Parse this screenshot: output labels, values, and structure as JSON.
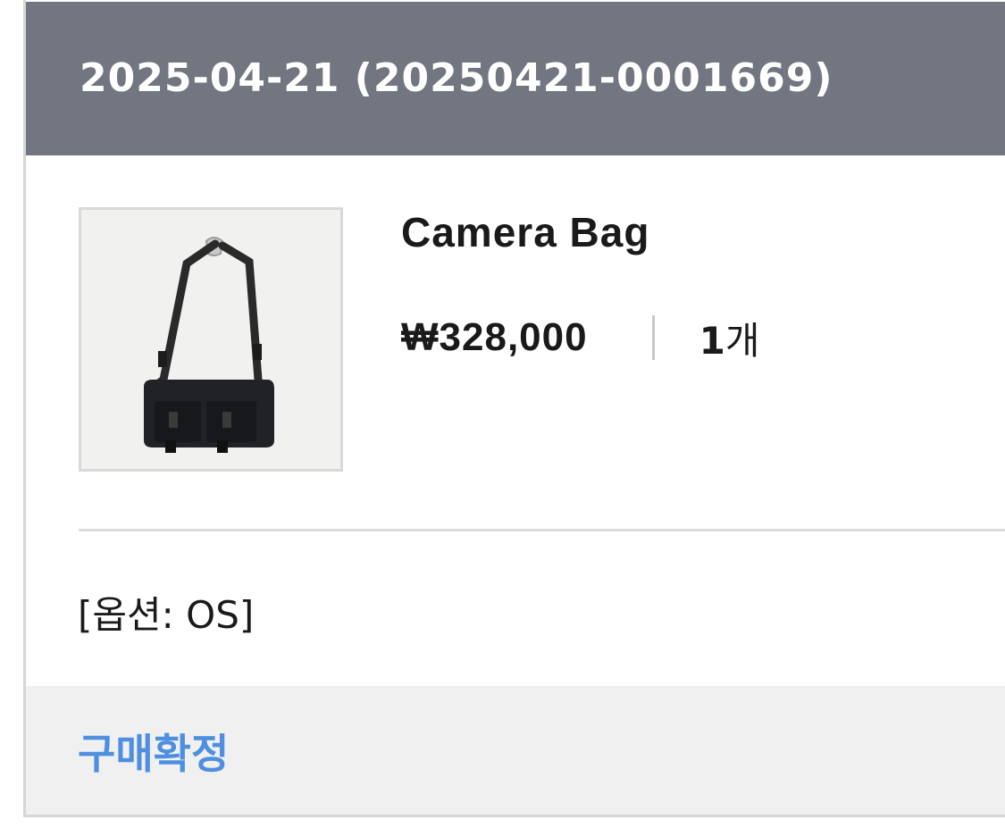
{
  "order": {
    "header": "2025-04-21 (20250421-0001669)"
  },
  "item": {
    "image_alt": "Camera Bag",
    "name": "Camera Bag",
    "price": "₩328,000",
    "quantity_number": "1",
    "quantity_unit": "개",
    "option": "[옵션: OS]"
  },
  "actions": {
    "confirm_label": "구매확정"
  },
  "colors": {
    "header_bg": "#717680",
    "footer_bg": "#f0f0f0",
    "confirm_text": "#4f8fe0"
  }
}
